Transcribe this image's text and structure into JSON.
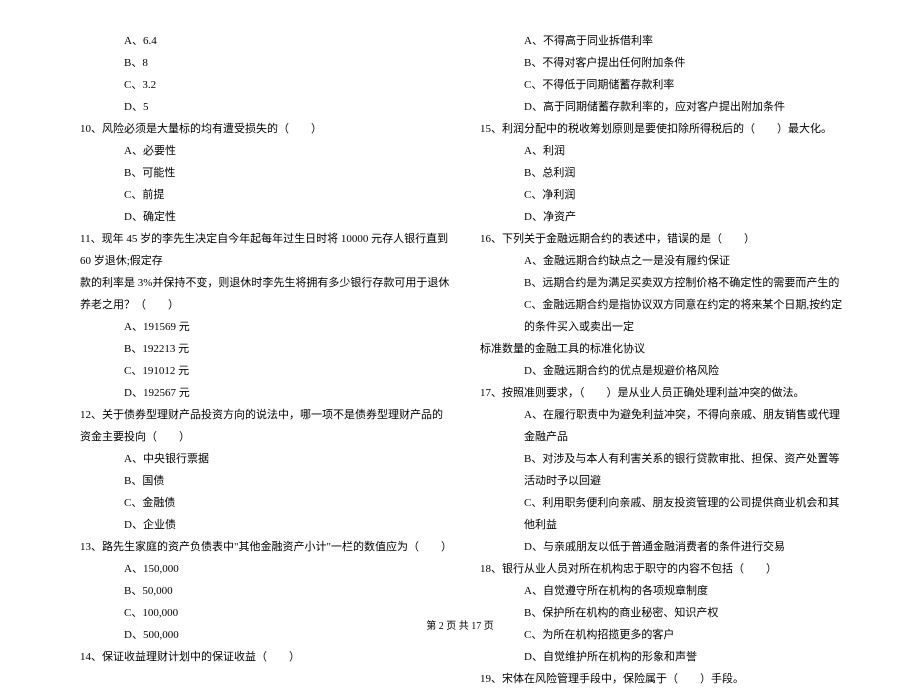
{
  "left": {
    "q9_opts": {
      "a": "A、6.4",
      "b": "B、8",
      "c": "C、3.2",
      "d": "D、5"
    },
    "q10": {
      "stem": "10、风险必须是大量标的均有遭受损失的（　　）",
      "a": "A、必要性",
      "b": "B、可能性",
      "c": "C、前提",
      "d": "D、确定性"
    },
    "q11": {
      "stem1": "11、现年 45 岁的李先生决定自今年起每年过生日时将 10000 元存人银行直到 60 岁退休;假定存",
      "stem2": "款的利率是 3%并保持不变，则退休时李先生将拥有多少银行存款可用于退休养老之用？（　　）",
      "a": "A、191569 元",
      "b": "B、192213 元",
      "c": "C、191012 元",
      "d": "D、192567 元"
    },
    "q12": {
      "stem": "12、关于债券型理财产品投资方向的说法中，哪一项不是债券型理财产品的资金主要投向（　　）",
      "a": "A、中央银行票据",
      "b": "B、国债",
      "c": "C、金融债",
      "d": "D、企业债"
    },
    "q13": {
      "stem": "13、路先生家庭的资产负债表中\"其他金融资产小计\"一栏的数值应为（　　）",
      "a": "A、150,000",
      "b": "B、50,000",
      "c": "C、100,000",
      "d": "D、500,000"
    },
    "q14": {
      "stem": "14、保证收益理财计划中的保证收益（　　）"
    }
  },
  "right": {
    "q14_opts": {
      "a": "A、不得高于同业拆借利率",
      "b": "B、不得对客户提出任何附加条件",
      "c": "C、不得低于同期储蓄存款利率",
      "d": "D、高于同期储蓄存款利率的，应对客户提出附加条件"
    },
    "q15": {
      "stem": "15、利润分配中的税收筹划原则是要使扣除所得税后的（　　）最大化。",
      "a": "A、利润",
      "b": "B、总利润",
      "c": "C、净利润",
      "d": "D、净资产"
    },
    "q16": {
      "stem": "16、下列关于金融远期合约的表述中，错误的是（　　）",
      "a": "A、金融远期合约缺点之一是没有履约保证",
      "b": "B、远期合约是为满足买卖双方控制价格不确定性的需要而产生的",
      "c1": "C、金融远期合约是指协议双方同意在约定的将来某个日期,按约定的条件买入或卖出一定",
      "c2": "标准数量的金融工具的标准化协议",
      "d": "D、金融远期合约的优点是规避价格风险"
    },
    "q17": {
      "stem": "17、按照准则要求，（　　）是从业人员正确处理利益冲突的做法。",
      "a": "A、在履行职责中为避免利益冲突，不得向亲戚、朋友销售或代理金融产品",
      "b": "B、对涉及与本人有利害关系的银行贷款审批、担保、资产处置等活动时予以回避",
      "c": "C、利用职务便利向亲戚、朋友投资管理的公司提供商业机会和其他利益",
      "d": "D、与亲戚朋友以低于普通金融消费者的条件进行交易"
    },
    "q18": {
      "stem": "18、银行从业人员对所在机构忠于职守的内容不包括（　　）",
      "a": "A、自觉遵守所在机构的各项规章制度",
      "b": "B、保护所在机构的商业秘密、知识产权",
      "c": "C、为所在机构招揽更多的客户",
      "d": "D、自觉维护所在机构的形象和声誉"
    },
    "q19": {
      "stem": "19、宋体在风险管理手段中，保险属于（　　）手段。"
    }
  },
  "footer": "第 2 页 共 17 页"
}
